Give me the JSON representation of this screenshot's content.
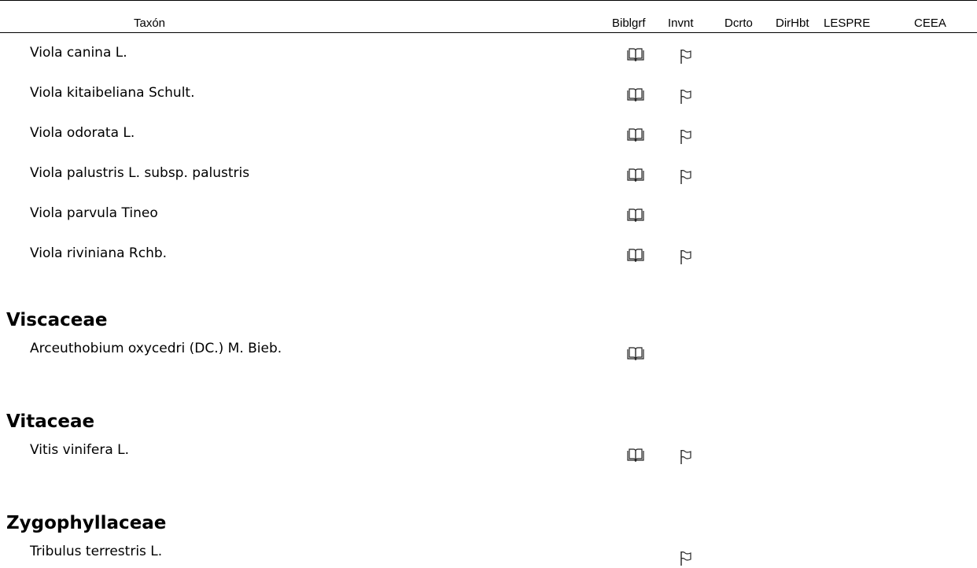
{
  "header": {
    "taxon": "Taxón",
    "biblgrf": "Biblgrf",
    "invnt": "Invnt",
    "dcrto": "Dcrto",
    "dirhbt": "DirHbt",
    "lespre": "LESPRE",
    "ceea": "CEEA"
  },
  "icons": {
    "bibliography": "book-icon",
    "inventory": "flag-icon"
  },
  "viola": [
    {
      "name": "Viola canina L.",
      "biblgrf": true,
      "invnt": true
    },
    {
      "name": "Viola kitaibeliana Schult.",
      "biblgrf": true,
      "invnt": true
    },
    {
      "name": "Viola odorata L.",
      "biblgrf": true,
      "invnt": true
    },
    {
      "name": "Viola palustris L. subsp. palustris",
      "biblgrf": true,
      "invnt": true
    },
    {
      "name": "Viola parvula Tineo",
      "biblgrf": true,
      "invnt": false
    },
    {
      "name": "Viola riviniana Rchb.",
      "biblgrf": true,
      "invnt": true
    }
  ],
  "viscaceae": {
    "family": "Viscaceae",
    "taxa": [
      {
        "name": "Arceuthobium oxycedri (DC.) M. Bieb.",
        "biblgrf": true,
        "invnt": false
      }
    ]
  },
  "vitaceae": {
    "family": "Vitaceae",
    "taxa": [
      {
        "name": "Vitis vinifera L.",
        "biblgrf": true,
        "invnt": true
      }
    ]
  },
  "zygophyllaceae": {
    "family": "Zygophyllaceae",
    "taxa": [
      {
        "name": "Tribulus terrestris L.",
        "biblgrf": false,
        "invnt": true
      }
    ]
  }
}
